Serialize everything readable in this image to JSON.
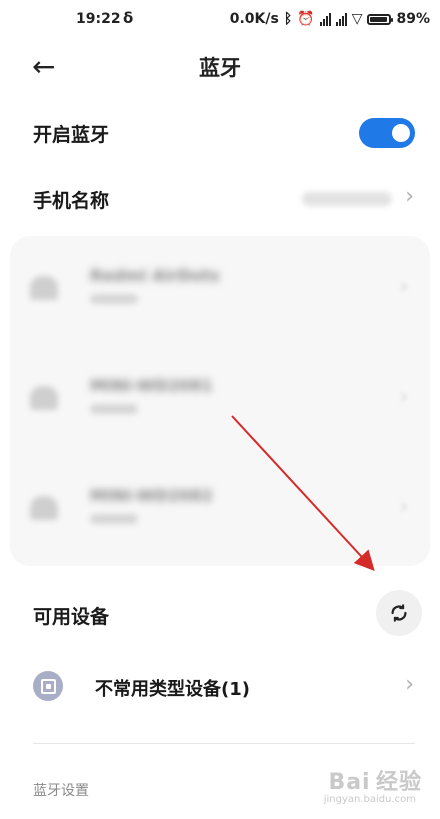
{
  "status_bar": {
    "time": "19:22",
    "sync_glyph": "δ",
    "net_speed": "0.0K/s",
    "bluetooth_glyph": "ᛒ",
    "alarm_glyph": "⏰",
    "wifi_glyph": "▽",
    "battery_text": "89%",
    "battery_level": 0.89
  },
  "header": {
    "back_glyph": "←",
    "title": "蓝牙"
  },
  "bluetooth_toggle": {
    "label": "开启蓝牙",
    "on": true,
    "accent": "#1f7ae8"
  },
  "phone_name": {
    "label": "手机名称",
    "chevron": "›"
  },
  "paired_devices": [
    {
      "name": "Redmi AirDots",
      "chevron": "›"
    },
    {
      "name": "MINI-WD2081",
      "chevron": "›"
    },
    {
      "name": "MINI-WD2082",
      "chevron": "›"
    }
  ],
  "available": {
    "label": "可用设备",
    "refresh_icon": "refresh-icon"
  },
  "uncommon": {
    "label": "不常用类型设备(1)",
    "chevron": "›"
  },
  "settings_header": "蓝牙设置",
  "watermark": {
    "main": "Bai 经验",
    "sub": "jingyan.baidu.com"
  },
  "annotation": {
    "color": "#d42a2a"
  }
}
